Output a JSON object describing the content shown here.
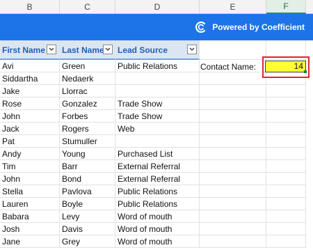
{
  "column_headers": [
    "B",
    "C",
    "D",
    "E",
    "F"
  ],
  "selected_column": "F",
  "banner": {
    "brand_text": "Powered by Coefficient",
    "color": "#1d74e8"
  },
  "table": {
    "headers": [
      "First Name",
      "Last Name",
      "Lead Source"
    ],
    "rows": [
      [
        "Avi",
        "Green",
        "Public Relations"
      ],
      [
        "Siddartha",
        "Nedaerk",
        ""
      ],
      [
        "Jake",
        "Llorrac",
        ""
      ],
      [
        "Rose",
        "Gonzalez",
        "Trade Show"
      ],
      [
        "John",
        "Forbes",
        "Trade Show"
      ],
      [
        "Jack",
        "Rogers",
        "Web"
      ],
      [
        "Pat",
        "Stumuller",
        ""
      ],
      [
        "Andy",
        "Young",
        "Purchased List"
      ],
      [
        "Tim",
        "Barr",
        "External Referral"
      ],
      [
        "John",
        "Bond",
        "External Referral"
      ],
      [
        "Stella",
        "Pavlova",
        "Public Relations"
      ],
      [
        "Lauren",
        "Boyle",
        "Public Relations"
      ],
      [
        "Babara",
        "Levy",
        "Word of mouth"
      ],
      [
        "Josh",
        "Davis",
        "Word of mouth"
      ],
      [
        "Jane",
        "Grey",
        "Word of mouth"
      ]
    ]
  },
  "contact": {
    "label": "Contact Name:",
    "value": "14",
    "highlight_color": "#ffff33",
    "outline_color": "#e0252b"
  }
}
